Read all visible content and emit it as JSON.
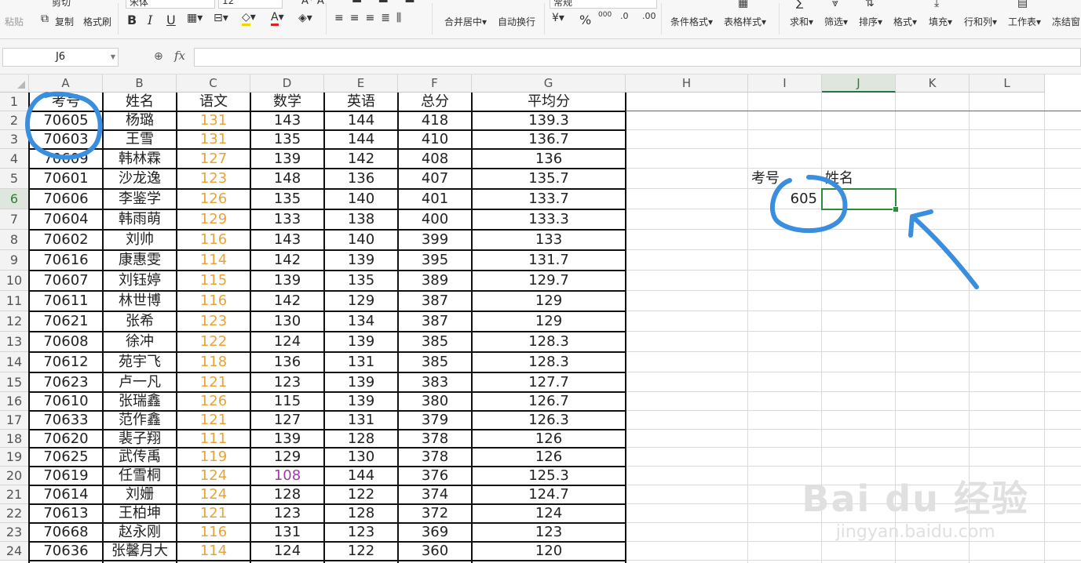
{
  "ribbon": {
    "paste": "粘贴",
    "cut": "剪切",
    "copy": "复制",
    "format_painter": "格式刷",
    "font_name": "宋体",
    "font_size": "12",
    "bold": "B",
    "italic": "I",
    "underline": "U",
    "merge_center": "合并居中",
    "wrap_text": "自动换行",
    "number_format": "常规",
    "percent": "%",
    "thousands": "000",
    "cond_format": "条件格式",
    "table_style": "表格样式",
    "sum": "求和",
    "filter": "筛选",
    "sort": "排序",
    "format": "格式",
    "fill": "填充",
    "rows_cols": "行和列",
    "worksheet": "工作表",
    "freeze": "冻结窗"
  },
  "formula_bar": {
    "name_box": "J6",
    "fx": "fx",
    "formula": ""
  },
  "columns": [
    "A",
    "B",
    "C",
    "D",
    "E",
    "F",
    "G",
    "H",
    "I",
    "J",
    "K",
    "L"
  ],
  "selected_column": "J",
  "selected_row": 6,
  "header_row": [
    "考号",
    "姓名",
    "语文",
    "数学",
    "英语",
    "总分",
    "平均分"
  ],
  "rows": [
    [
      "70605",
      "杨璐",
      "131",
      "143",
      "144",
      "418",
      "139.3"
    ],
    [
      "70603",
      "王雪",
      "131",
      "135",
      "144",
      "410",
      "136.7"
    ],
    [
      "70609",
      "韩林霖",
      "127",
      "139",
      "142",
      "408",
      "136"
    ],
    [
      "70601",
      "沙龙逸",
      "123",
      "148",
      "136",
      "407",
      "135.7"
    ],
    [
      "70606",
      "李鉴学",
      "126",
      "135",
      "140",
      "401",
      "133.7"
    ],
    [
      "70604",
      "韩雨萌",
      "129",
      "133",
      "138",
      "400",
      "133.3"
    ],
    [
      "70602",
      "刘帅",
      "116",
      "143",
      "140",
      "399",
      "133"
    ],
    [
      "70616",
      "康惠雯",
      "114",
      "142",
      "139",
      "395",
      "131.7"
    ],
    [
      "70607",
      "刘钰婷",
      "115",
      "139",
      "135",
      "389",
      "129.7"
    ],
    [
      "70611",
      "林世博",
      "116",
      "142",
      "129",
      "387",
      "129"
    ],
    [
      "70621",
      "张希",
      "123",
      "130",
      "134",
      "387",
      "129"
    ],
    [
      "70608",
      "徐冲",
      "122",
      "124",
      "139",
      "385",
      "128.3"
    ],
    [
      "70612",
      "苑宇飞",
      "118",
      "136",
      "131",
      "385",
      "128.3"
    ],
    [
      "70623",
      "卢一凡",
      "121",
      "123",
      "139",
      "383",
      "127.7"
    ],
    [
      "70610",
      "张瑞鑫",
      "126",
      "115",
      "139",
      "380",
      "126.7"
    ],
    [
      "70633",
      "范作鑫",
      "121",
      "127",
      "131",
      "379",
      "126.3"
    ],
    [
      "70620",
      "裴子翔",
      "111",
      "139",
      "128",
      "378",
      "126"
    ],
    [
      "70625",
      "武传禹",
      "119",
      "129",
      "130",
      "378",
      "126"
    ],
    [
      "70619",
      "任雪桐",
      "124",
      "108",
      "144",
      "376",
      "125.3"
    ],
    [
      "70614",
      "刘姗",
      "124",
      "128",
      "122",
      "374",
      "124.7"
    ],
    [
      "70613",
      "王柏坤",
      "121",
      "123",
      "128",
      "372",
      "124"
    ],
    [
      "70668",
      "赵永刚",
      "116",
      "131",
      "123",
      "369",
      "123"
    ],
    [
      "70636",
      "张馨月大",
      "114",
      "124",
      "122",
      "360",
      "120"
    ]
  ],
  "lookup": {
    "label_id": "考号",
    "label_name": "姓名",
    "value_id": "605",
    "value_name": ""
  },
  "colors": {
    "chinese_score": "#e8a33a",
    "low_math": "#9b3fa6",
    "annotation": "#3a8ee0",
    "active": "#2e8b3a"
  },
  "watermark": {
    "logo": "Bai du 经验",
    "url": "jingyan.baidu.com"
  }
}
